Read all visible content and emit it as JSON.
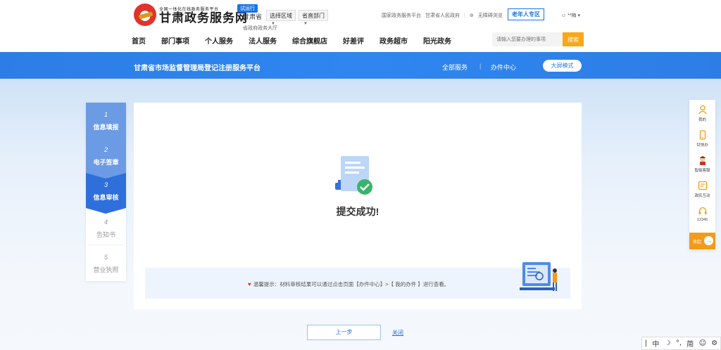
{
  "header": {
    "logo_sub": "全国一体化在线政务服务平台",
    "logo_main": "甘肃政务服务网",
    "beta": "试运行",
    "region": "甘肃省",
    "select_area": "选择区域",
    "select_dept": "省直部门",
    "hall_link": "省政府政务大厅",
    "top_links": [
      "国家政务服务平台",
      "甘肃省人民政府",
      "无障碍浏览"
    ],
    "elder_zone": "老年人专区",
    "user": "**梅",
    "nav": [
      "首页",
      "部门事项",
      "个人服务",
      "法人服务",
      "综合旗舰店",
      "好差评",
      "政务超市",
      "阳光政务"
    ],
    "search_placeholder": "请输入您要办理的事项",
    "search_btn": "搜索"
  },
  "banner": {
    "title": "甘肃省市场监督管理局登记注册服务平台",
    "link_all": "全部服务",
    "link_center": "办件中心",
    "screen_mode": "大屏模式"
  },
  "steps": [
    {
      "num": "1",
      "label": "信息填报",
      "state": "done"
    },
    {
      "num": "2",
      "label": "电子签章",
      "state": "done"
    },
    {
      "num": "3",
      "label": "信息审核",
      "state": "active"
    },
    {
      "num": "4",
      "label": "告知书",
      "state": "todo"
    },
    {
      "num": "5",
      "label": "营业执照",
      "state": "todo"
    }
  ],
  "main": {
    "success_title": "提交成功!",
    "tip": "温馨提示：材料审核结果可以通过点击页面【办件中心】>【 我的办件 】进行查看。"
  },
  "footer_buttons": {
    "prev": "上一步",
    "close": "关闭"
  },
  "right_bar": [
    {
      "label": "我的",
      "icon": "user-icon"
    },
    {
      "label": "甘快办",
      "icon": "phone-icon"
    },
    {
      "label": "智能客服",
      "icon": "service-avatar-icon"
    },
    {
      "label": "政民互动",
      "icon": "message-icon"
    },
    {
      "label": "12345",
      "icon": "headset-icon"
    }
  ],
  "right_bar_bottom": "收起",
  "ime": [
    "中",
    "°,",
    "简"
  ],
  "colors": {
    "primary": "#2f6fdb",
    "banner": "#2d7de6",
    "accent": "#f9a814",
    "success": "#2ea44f"
  }
}
